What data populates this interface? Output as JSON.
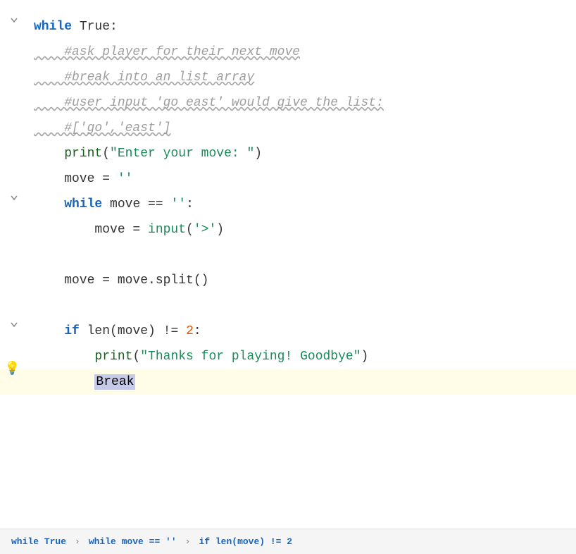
{
  "editor": {
    "lines": [
      {
        "id": "line1",
        "indent": 0,
        "has_gutter_icon": true,
        "gutter_icon": "arrow-down-icon",
        "highlighted": false,
        "segments": [
          {
            "text": "while",
            "class": "kw"
          },
          {
            "text": " True:",
            "class": "var"
          }
        ]
      },
      {
        "id": "line2",
        "indent": 1,
        "has_gutter_icon": false,
        "highlighted": false,
        "segments": [
          {
            "text": "    #ask player for their next move",
            "class": "comment squiggly-gray"
          }
        ]
      },
      {
        "id": "line3",
        "indent": 1,
        "has_gutter_icon": false,
        "highlighted": false,
        "segments": [
          {
            "text": "    #break into an list array",
            "class": "comment squiggly-gray"
          }
        ]
      },
      {
        "id": "line4",
        "indent": 1,
        "has_gutter_icon": false,
        "highlighted": false,
        "segments": [
          {
            "text": "    #user input 'go east' would give the list:",
            "class": "comment squiggly-gray"
          }
        ]
      },
      {
        "id": "line5",
        "indent": 1,
        "has_gutter_icon": false,
        "highlighted": false,
        "segments": [
          {
            "text": "    #['go','east']",
            "class": "comment squiggly-gray"
          }
        ]
      },
      {
        "id": "line6",
        "indent": 1,
        "has_gutter_icon": false,
        "highlighted": false,
        "segments": [
          {
            "text": "    ",
            "class": "var"
          },
          {
            "text": "print",
            "class": "func"
          },
          {
            "text": "(",
            "class": "var"
          },
          {
            "text": "\"Enter your move: \"",
            "class": "string"
          },
          {
            "text": ")",
            "class": "var"
          }
        ]
      },
      {
        "id": "line7",
        "indent": 1,
        "has_gutter_icon": false,
        "highlighted": false,
        "segments": [
          {
            "text": "    move = ",
            "class": "var"
          },
          {
            "text": "''",
            "class": "string"
          }
        ]
      },
      {
        "id": "line8",
        "indent": 1,
        "has_gutter_icon": true,
        "gutter_icon": "arrow-down-icon",
        "highlighted": false,
        "segments": [
          {
            "text": "    ",
            "class": "var"
          },
          {
            "text": "while",
            "class": "kw"
          },
          {
            "text": " move == ",
            "class": "var"
          },
          {
            "text": "''",
            "class": "string"
          },
          {
            "text": ":",
            "class": "var"
          }
        ]
      },
      {
        "id": "line9",
        "indent": 2,
        "has_gutter_icon": false,
        "highlighted": false,
        "segments": [
          {
            "text": "        move = ",
            "class": "var"
          },
          {
            "text": "input",
            "class": "builtin"
          },
          {
            "text": "(",
            "class": "var"
          },
          {
            "text": "'>'",
            "class": "string"
          },
          {
            "text": ")",
            "class": "var"
          }
        ]
      },
      {
        "id": "line10",
        "indent": 1,
        "has_gutter_icon": false,
        "highlighted": false,
        "segments": [
          {
            "text": "",
            "class": "var"
          }
        ]
      },
      {
        "id": "line11",
        "indent": 1,
        "has_gutter_icon": false,
        "highlighted": false,
        "segments": [
          {
            "text": "    move = move.split()",
            "class": "var"
          }
        ]
      },
      {
        "id": "line12",
        "indent": 1,
        "has_gutter_icon": false,
        "highlighted": false,
        "segments": [
          {
            "text": "",
            "class": "var"
          }
        ]
      },
      {
        "id": "line13",
        "indent": 1,
        "has_gutter_icon": true,
        "gutter_icon": "arrow-down-icon",
        "highlighted": false,
        "segments": [
          {
            "text": "    ",
            "class": "var"
          },
          {
            "text": "if",
            "class": "kw"
          },
          {
            "text": " len(move) != ",
            "class": "var"
          },
          {
            "text": "2",
            "class": "num"
          },
          {
            "text": ":",
            "class": "var"
          }
        ]
      },
      {
        "id": "line14",
        "indent": 2,
        "has_gutter_icon": false,
        "highlighted": false,
        "segments": [
          {
            "text": "        ",
            "class": "var"
          },
          {
            "text": "print",
            "class": "func"
          },
          {
            "text": "(",
            "class": "var"
          },
          {
            "text": "\"Thanks for playing! Goodbye\"",
            "class": "string"
          },
          {
            "text": ")",
            "class": "var"
          }
        ]
      },
      {
        "id": "line15",
        "indent": 2,
        "has_gutter_icon": true,
        "gutter_icon": "bulb-icon",
        "highlighted": true,
        "segments": [
          {
            "text": "        ",
            "class": "var"
          },
          {
            "text": "Break",
            "class": "var selected"
          }
        ]
      }
    ],
    "breadcrumbs": [
      {
        "text": "while True",
        "class": "kw"
      },
      {
        "text": ">",
        "class": "arrow"
      },
      {
        "text": "while move == ''",
        "class": "kw"
      },
      {
        "text": ">",
        "class": "arrow"
      },
      {
        "text": "if len(move) != 2",
        "class": "kw"
      }
    ]
  }
}
